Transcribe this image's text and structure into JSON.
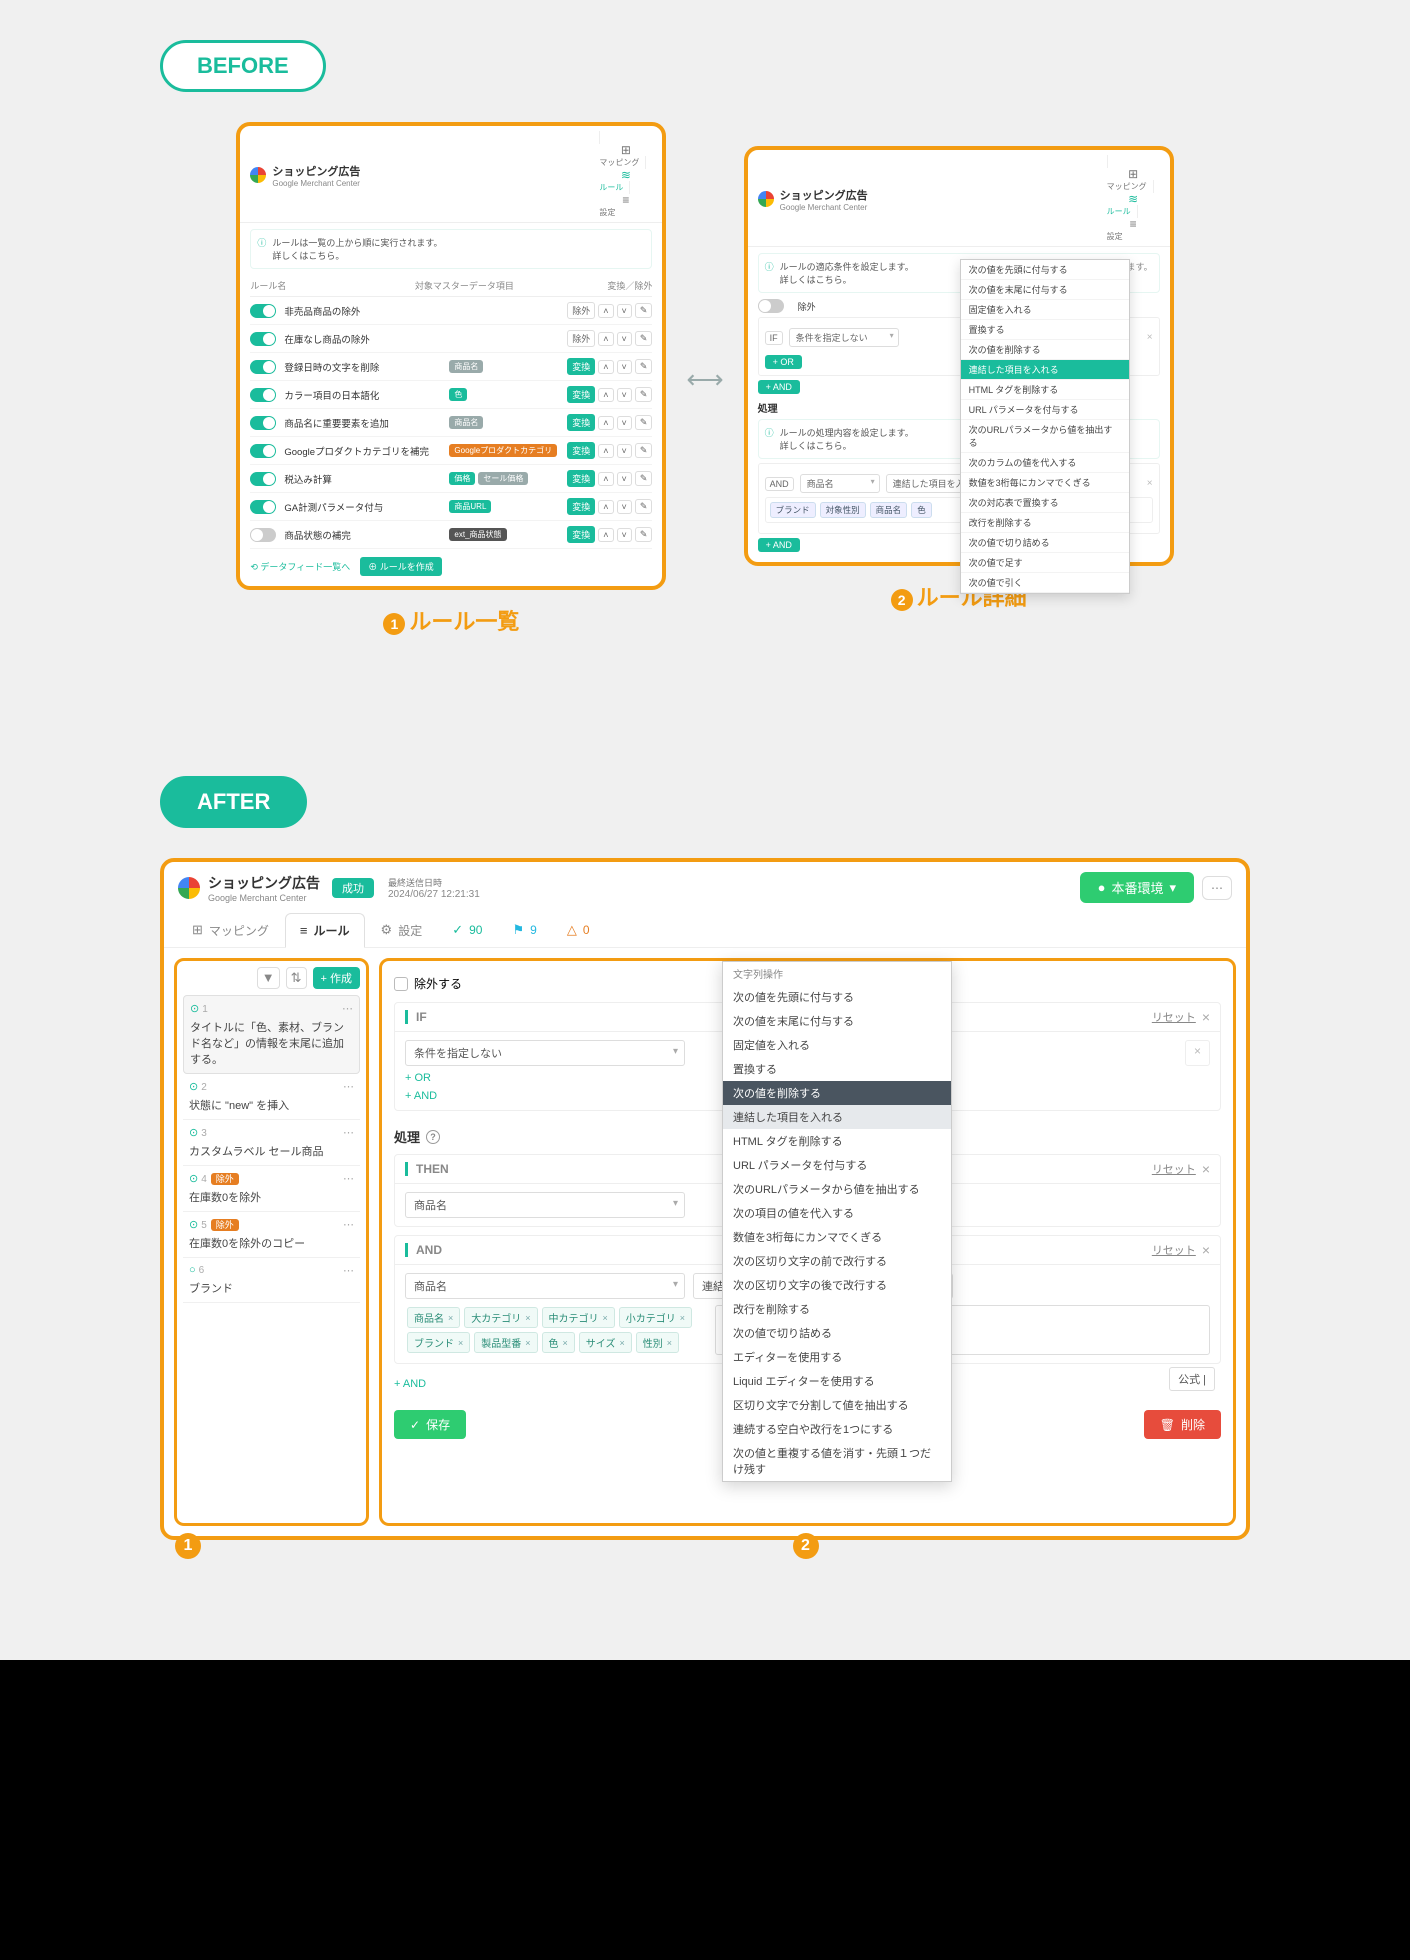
{
  "labels": {
    "before": "BEFORE",
    "after": "AFTER",
    "caption1": "ルール一覧",
    "caption2": "ルール詳細"
  },
  "before_left": {
    "title": "ショッピング広告",
    "subtitle": "Google Merchant Center",
    "tabs": [
      {
        "icon": "⊞",
        "label": "マッピング"
      },
      {
        "icon": "≋",
        "label": "ルール"
      },
      {
        "icon": "≡",
        "label": "設定"
      }
    ],
    "info": "ルールは一覧の上から順に実行されます。\n詳しくはこちら。",
    "cols": [
      "ルール名",
      "対象マスターデータ項目",
      "変換／除外"
    ],
    "rows": [
      {
        "on": true,
        "name": "非売品商品の除外",
        "tags": [],
        "type": "除外"
      },
      {
        "on": true,
        "name": "在庫なし商品の除外",
        "tags": [],
        "type": "除外"
      },
      {
        "on": true,
        "name": "登録日時の文字を削除",
        "tags": [
          {
            "t": "商品名",
            "c": "gray"
          }
        ],
        "type": "変換"
      },
      {
        "on": true,
        "name": "カラー項目の日本語化",
        "tags": [
          {
            "t": "色",
            "c": "teal"
          }
        ],
        "type": "変換"
      },
      {
        "on": true,
        "name": "商品名に重要要素を追加",
        "tags": [
          {
            "t": "商品名",
            "c": "gray"
          }
        ],
        "type": "変換"
      },
      {
        "on": true,
        "name": "Googleプロダクトカテゴリを補完",
        "tags": [
          {
            "t": "Googleプロダクトカテゴリ",
            "c": "orange"
          }
        ],
        "type": "変換"
      },
      {
        "on": true,
        "name": "税込み計算",
        "tags": [
          {
            "t": "価格",
            "c": "teal"
          },
          {
            "t": "セール価格",
            "c": "gray"
          }
        ],
        "type": "変換"
      },
      {
        "on": true,
        "name": "GA計測パラメータ付与",
        "tags": [
          {
            "t": "商品URL",
            "c": "teal"
          }
        ],
        "type": "変換"
      },
      {
        "on": false,
        "name": "商品状態の補完",
        "tags": [
          {
            "t": "ext_商品状態",
            "c": "dark"
          }
        ],
        "type": "変換"
      }
    ],
    "footer_link": "データフィード一覧へ",
    "footer_btn": "ルールを作成"
  },
  "before_right": {
    "title": "ショッピング広告",
    "subtitle": "Google Merchant Center",
    "tabs": [
      {
        "icon": "⊞",
        "label": "マッピング"
      },
      {
        "icon": "≋",
        "label": "ルール"
      },
      {
        "icon": "≡",
        "label": "設定"
      }
    ],
    "info": "ルールの適応条件を設定します。\n詳しくはこちら。",
    "trail": "条件を適用します。",
    "exclude_label": "除外",
    "if_label": "IF",
    "if_value": "条件を指定しない",
    "or": "+ OR",
    "and": "+ AND",
    "process": "処理",
    "info2": "ルールの処理内容を設定します。\n詳しくはこちら。",
    "and_label": "AND",
    "field_select": "商品名",
    "action_select": "連結した項目を入れる",
    "tags": [
      "ブランド",
      "対象性別",
      "商品名",
      "色"
    ],
    "menu": [
      "次の値を先頭に付与する",
      "次の値を末尾に付与する",
      "固定値を入れる",
      "置換する",
      "次の値を削除する",
      "連結した項目を入れる",
      "HTML タグを削除する",
      "URL パラメータを付与する",
      "次のURLパラメータから値を抽出する",
      "次のカラムの値を代入する",
      "数値を3桁毎にカンマでくぎる",
      "次の対応表で置換する",
      "改行を削除する",
      "次の値で切り詰める",
      "次の値で足す",
      "次の値で引く"
    ],
    "menu_hl": 5
  },
  "after": {
    "title": "ショッピング広告",
    "subtitle": "Google Merchant Center",
    "status": "成功",
    "meta_label": "最終送信日時",
    "meta_value": "2024/06/27 12:21:31",
    "env_btn": "本番環境",
    "tabs": [
      {
        "icon": "⊞",
        "label": "マッピング"
      },
      {
        "icon": "≡",
        "label": "ルール",
        "active": true
      },
      {
        "icon": "⚙",
        "label": "設定"
      },
      {
        "icon": "✓",
        "label": "90",
        "color": "#1abc9c"
      },
      {
        "icon": "⚑",
        "label": "9",
        "color": "#23b8e0"
      },
      {
        "icon": "△",
        "label": "0",
        "color": "#e67e22"
      }
    ],
    "side": {
      "create": "+ 作成",
      "items": [
        {
          "num": "1",
          "dot": true,
          "active": true,
          "title": "タイトルに「色、素材、ブランド名など」の情報を末尾に追加する。"
        },
        {
          "num": "2",
          "dot": true,
          "title": "状態に \"new\" を挿入"
        },
        {
          "num": "3",
          "dot": true,
          "title": "カスタムラベル セール商品"
        },
        {
          "num": "4",
          "dot": true,
          "badge": "除外",
          "title": "在庫数0を除外"
        },
        {
          "num": "5",
          "dot": true,
          "badge": "除外",
          "title": "在庫数0を除外のコピー"
        },
        {
          "num": "6",
          "dot": false,
          "title": "ブランド"
        }
      ]
    },
    "main": {
      "exclude": "除外する",
      "if": {
        "label": "IF",
        "value": "条件を指定しない",
        "reset": "リセット",
        "or": "+ OR",
        "and": "+ AND"
      },
      "process": "処理",
      "then": {
        "label": "THEN",
        "reset": "リセット",
        "field": "商品名",
        "extra": "公式 |"
      },
      "and": {
        "label": "AND",
        "reset": "リセット",
        "field": "商品名",
        "action": "連結した項目を入れる",
        "placeholder": "/",
        "tags": [
          "商品名",
          "大カテゴリ",
          "中カテゴリ",
          "小カテゴリ",
          "ブランド",
          "製品型番",
          "色",
          "サイズ",
          "性別"
        ]
      },
      "add_and": "+ AND",
      "save": "保存",
      "delete": "削除"
    },
    "menu": {
      "header": "文字列操作",
      "items": [
        "次の値を先頭に付与する",
        "次の値を末尾に付与する",
        "固定値を入れる",
        "置換する",
        "次の値を削除する",
        "連結した項目を入れる",
        "HTML タグを削除する",
        "URL パラメータを付与する",
        "次のURLパラメータから値を抽出する",
        "次の項目の値を代入する",
        "数値を3桁毎にカンマでくぎる",
        "次の区切り文字の前で改行する",
        "次の区切り文字の後で改行する",
        "改行を削除する",
        "次の値で切り詰める",
        "エディターを使用する",
        "Liquid エディターを使用する",
        "区切り文字で分割して値を抽出する",
        "連続する空白や改行を1つにする",
        "次の値と重複する値を消す・先頭１つだけ残す"
      ],
      "hl": 4,
      "hl2": 5
    }
  }
}
